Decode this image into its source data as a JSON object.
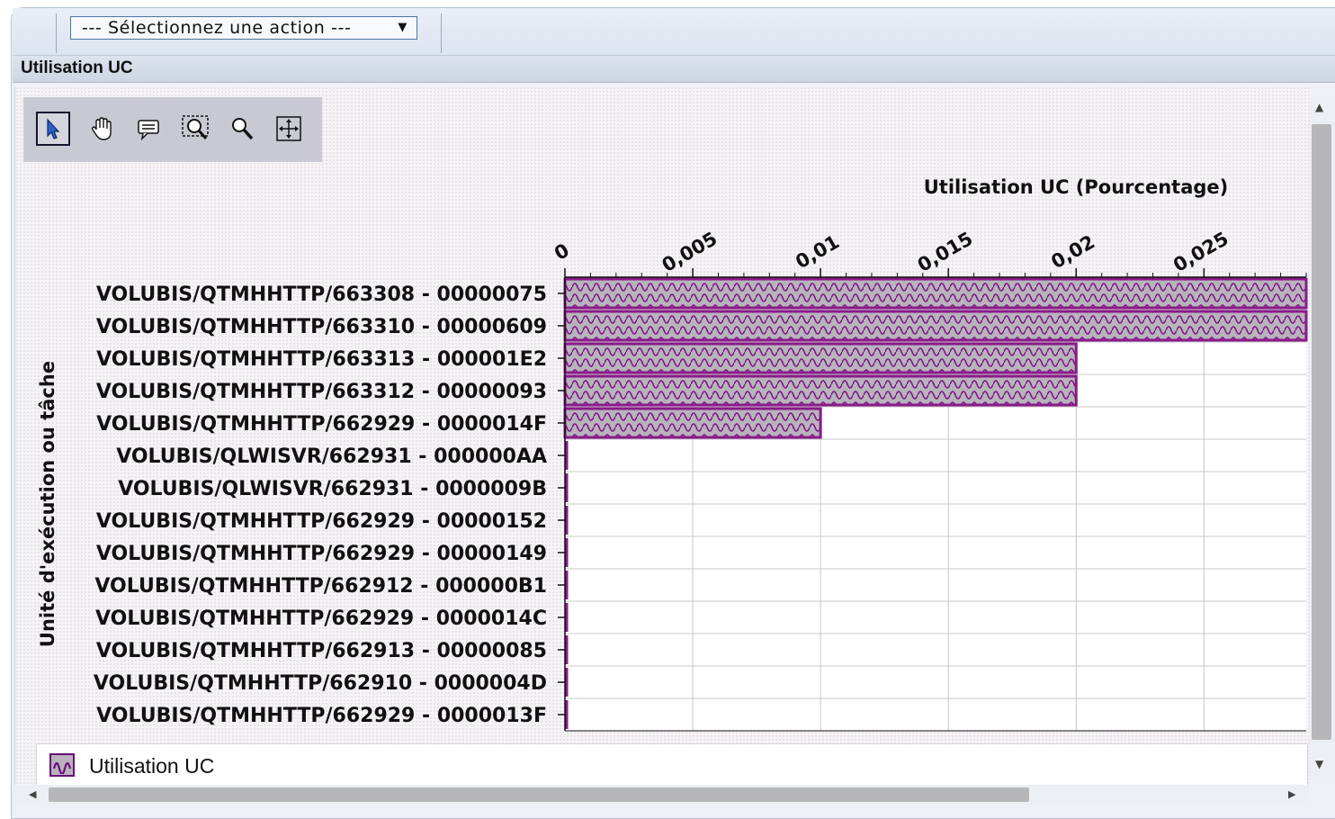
{
  "toolbar": {
    "action_select_label": "--- Sélectionnez une action ---"
  },
  "panel": {
    "title": "Utilisation UC"
  },
  "chart_tools": [
    "select-arrow-icon",
    "pan-hand-icon",
    "comment-icon",
    "zoom-area-icon",
    "zoom-icon",
    "crosshair-icon"
  ],
  "colors": {
    "bar_border": "#8a1a8a",
    "bar_fill": "#b8b3bc",
    "grid": "#c8c8c8"
  },
  "chart_data": {
    "type": "bar",
    "orientation": "horizontal",
    "xlabel": "Utilisation UC (Pourcentage)",
    "ylabel": "Unité d'exécution ou tâche",
    "xlim": [
      0,
      0.029
    ],
    "xticks": [
      "0",
      "0,005",
      "0,01",
      "0,015",
      "0,02",
      "0,025"
    ],
    "categories": [
      "VOLUBIS/QTMHHTTP/663308 - 00000075",
      "VOLUBIS/QTMHHTTP/663310 - 00000609",
      "VOLUBIS/QTMHHTTP/663313 - 000001E2",
      "VOLUBIS/QTMHHTTP/663312 - 00000093",
      "VOLUBIS/QTMHHTTP/662929 - 0000014F",
      "VOLUBIS/QLWISVR/662931 - 000000AA",
      "VOLUBIS/QLWISVR/662931 - 0000009B",
      "VOLUBIS/QTMHHTTP/662929 - 00000152",
      "VOLUBIS/QTMHHTTP/662929 - 00000149",
      "VOLUBIS/QTMHHTTP/662912 - 000000B1",
      "VOLUBIS/QTMHHTTP/662929 - 0000014C",
      "VOLUBIS/QTMHHTTP/662913 - 00000085",
      "VOLUBIS/QTMHHTTP/662910 - 0000004D",
      "VOLUBIS/QTMHHTTP/662929 - 0000013F"
    ],
    "series": [
      {
        "name": "Utilisation UC",
        "values": [
          0.03,
          0.03,
          0.02,
          0.02,
          0.01,
          0,
          0,
          0,
          0,
          0,
          0,
          0,
          0,
          0
        ]
      }
    ],
    "grid": true,
    "legend": "bottom-left"
  }
}
